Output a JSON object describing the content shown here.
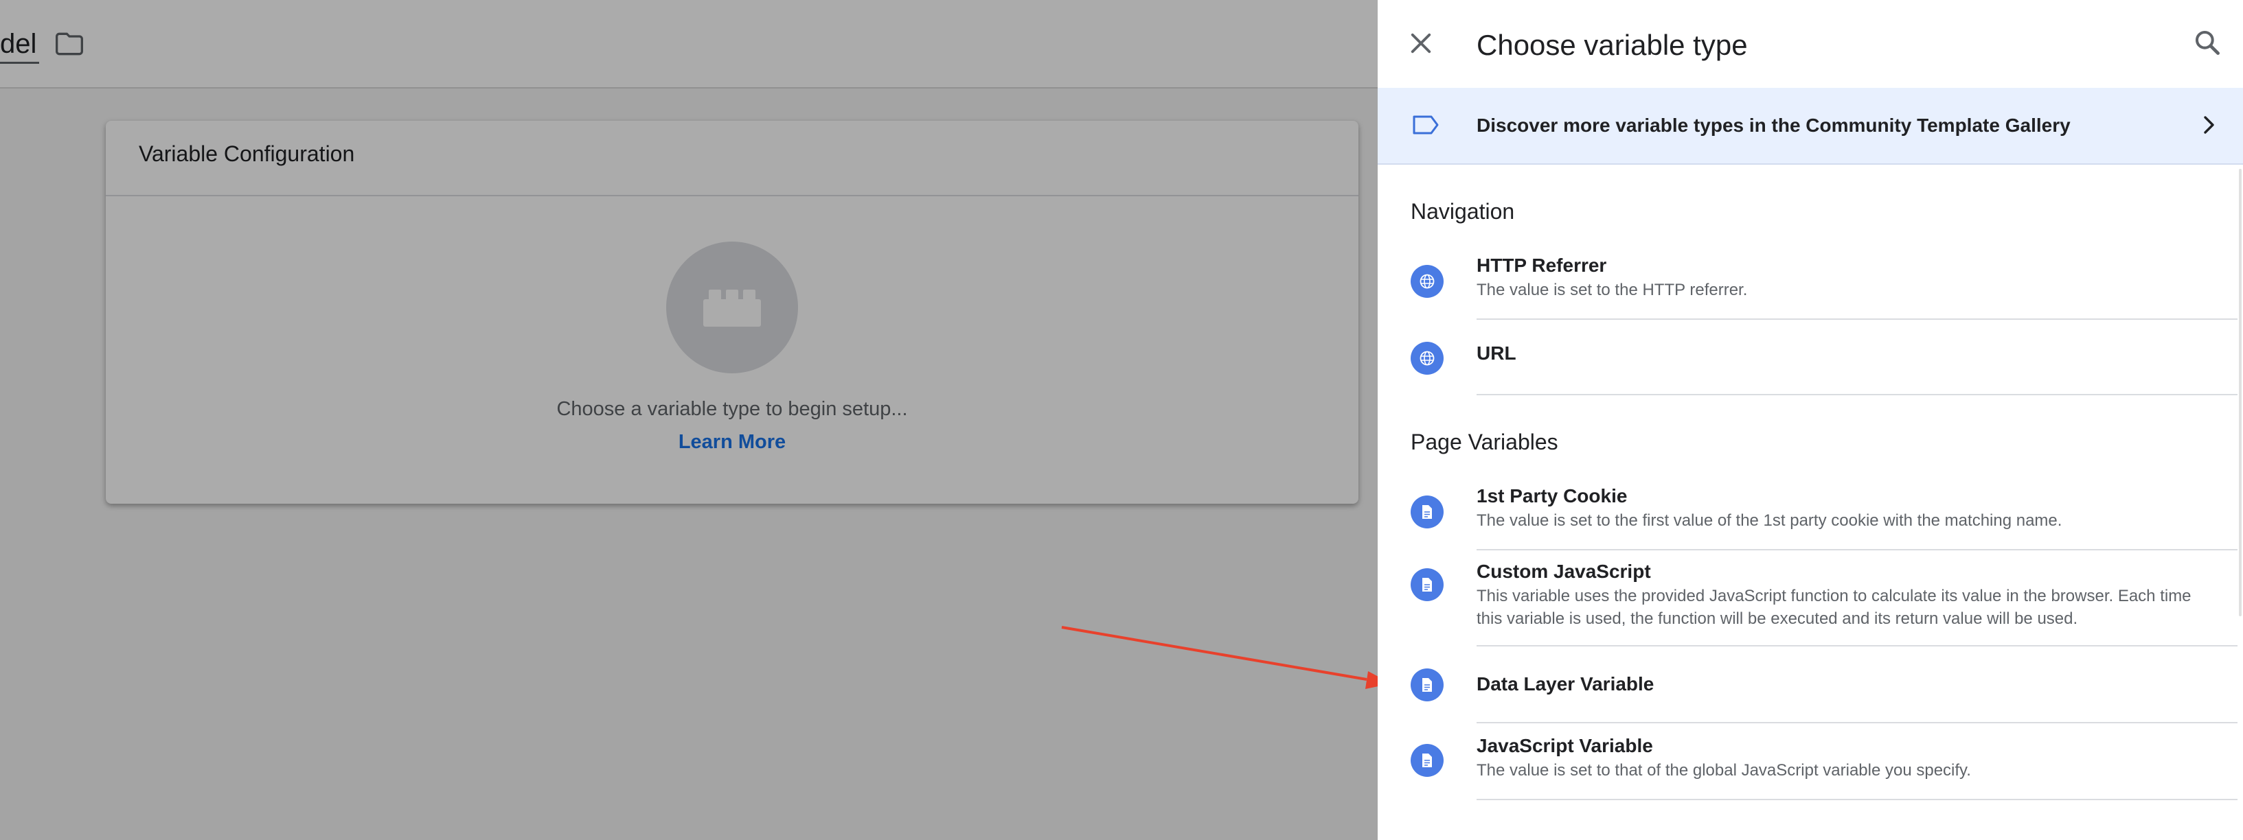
{
  "background": {
    "header": {
      "name_fragment": "del",
      "folder_icon": "folder-icon"
    },
    "card": {
      "title": "Variable Configuration",
      "placeholder_icon": "brick-icon",
      "hint": "Choose a variable type to begin setup...",
      "link": "Learn More"
    }
  },
  "panel": {
    "title": "Choose variable type",
    "close_icon": "close-icon",
    "search_icon": "search-icon",
    "gallery_banner": {
      "icon": "tag-icon",
      "text": "Discover more variable types in the Community Template Gallery",
      "chevron": "chevron-right-icon"
    },
    "sections": [
      {
        "title": "Navigation",
        "items": [
          {
            "name": "HTTP Referrer",
            "description": "The value is set to the HTTP referrer.",
            "icon": "globe-icon"
          },
          {
            "name": "URL",
            "description": "",
            "icon": "globe-icon"
          }
        ]
      },
      {
        "title": "Page Variables",
        "items": [
          {
            "name": "1st Party Cookie",
            "description": "The value is set to the first value of the 1st party cookie with the matching name.",
            "icon": "document-icon"
          },
          {
            "name": "Custom JavaScript",
            "description": "This variable uses the provided JavaScript function to calculate its value in the browser. Each time this variable is used, the function will be executed and its return value will be used.",
            "icon": "document-icon"
          },
          {
            "name": "Data Layer Variable",
            "description": "",
            "icon": "document-icon"
          },
          {
            "name": "JavaScript Variable",
            "description": "The value is set to that of the global JavaScript variable you specify.",
            "icon": "document-icon"
          }
        ]
      }
    ]
  },
  "colors": {
    "accent": "#1a73e8",
    "item_icon": "#4a7be4",
    "banner_bg": "#e8f0fe",
    "annotation_arrow": "#e8412c",
    "scrim": "#a7a7a7"
  }
}
